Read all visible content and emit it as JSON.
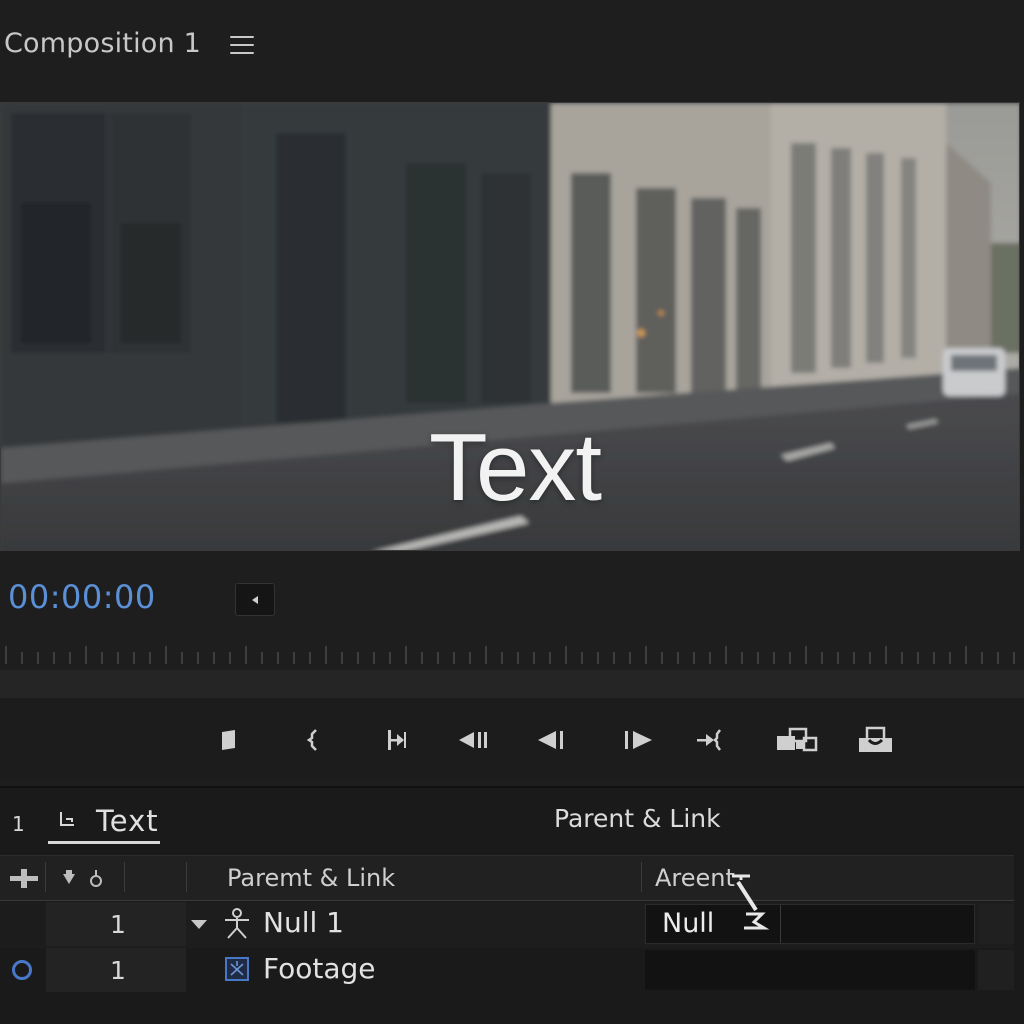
{
  "window": {
    "title": "Composition 1",
    "menu_icon": "hamburger-menu-icon"
  },
  "viewer": {
    "overlay_text": "Text"
  },
  "timebar": {
    "timecode": "00:00:00",
    "prev_frame_icon": "triangle-left-icon"
  },
  "transport": {
    "buttons": [
      {
        "name": "mark-in-button",
        "icon": "mark-in-icon"
      },
      {
        "name": "bracket-button",
        "icon": "bracket-icon"
      },
      {
        "name": "go-to-in-button",
        "icon": "go-to-in-icon"
      },
      {
        "name": "step-back-button",
        "icon": "step-back-icon"
      },
      {
        "name": "play-reverse-button",
        "icon": "play-reverse-icon"
      },
      {
        "name": "play-button",
        "icon": "play-icon"
      },
      {
        "name": "go-to-out-button",
        "icon": "go-to-out-icon"
      },
      {
        "name": "insert-button",
        "icon": "insert-icon"
      },
      {
        "name": "export-frame-button",
        "icon": "export-frame-icon"
      }
    ]
  },
  "panel": {
    "layer_number": "1",
    "tab": {
      "label": "Text",
      "icon": "text-layer-icon"
    },
    "parent_link_label": "Parent & Link"
  },
  "columns": {
    "parent_link": "Paremt & Link",
    "areent": "Areent"
  },
  "layers": [
    {
      "number": "1",
      "name": "Null 1",
      "icon": "null-object-icon",
      "parent": "Null",
      "expanded": true
    },
    {
      "number": "1",
      "name": "Footage",
      "icon": "footage-icon",
      "parent": ""
    }
  ],
  "colors": {
    "accent": "#5b8fd6",
    "visibility": "#4a78c8",
    "background": "#1e1e1e"
  }
}
